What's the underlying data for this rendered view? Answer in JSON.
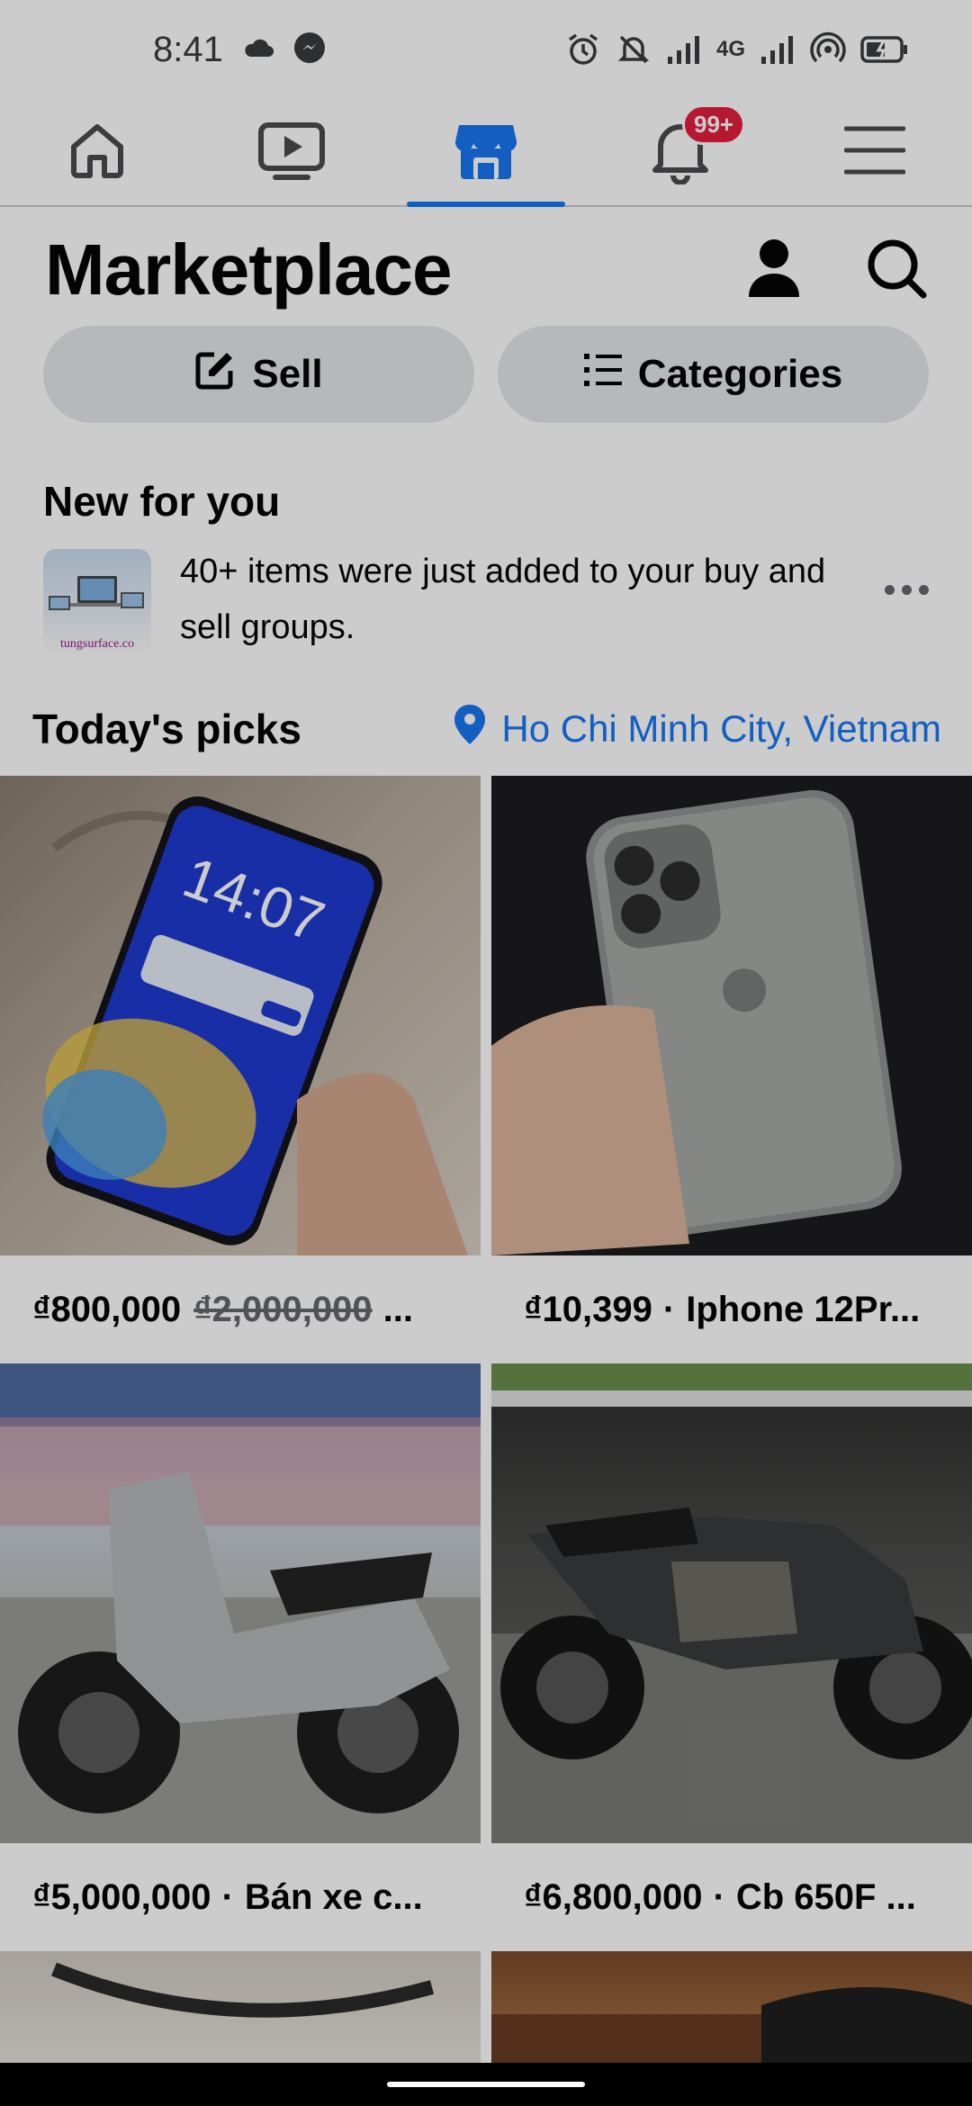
{
  "status_bar": {
    "time": "8:41",
    "network": "4G"
  },
  "top_nav": {
    "items": [
      {
        "name": "home",
        "icon": "home-icon"
      },
      {
        "name": "video",
        "icon": "video-icon"
      },
      {
        "name": "marketplace",
        "icon": "marketplace-icon",
        "active": true
      },
      {
        "name": "notifications",
        "icon": "bell-icon",
        "badge": "99+"
      },
      {
        "name": "menu",
        "icon": "hamburger-icon"
      }
    ]
  },
  "header": {
    "title": "Marketplace"
  },
  "actions": {
    "sell_label": "Sell",
    "categories_label": "Categories"
  },
  "new_for_you": {
    "title": "New for you",
    "message": "40+ items were just added to your buy and sell groups.",
    "thumb_caption": "tungsurface.co"
  },
  "todays_picks": {
    "title": "Today's picks",
    "location": "Ho Chi Minh City, Vietnam",
    "items": [
      {
        "price": "₫800,000",
        "original_price": "₫2,000,000",
        "suffix": "..."
      },
      {
        "price": "₫10,399",
        "name": "Iphone 12Pr..."
      },
      {
        "price": "₫5,000,000",
        "name": "Bán xe c..."
      },
      {
        "price": "₫6,800,000",
        "name": "Cb 650F ..."
      }
    ]
  },
  "colors": {
    "accent": "#1877f2",
    "badge": "#e41e3f",
    "pill_bg": "#e4e6eb"
  }
}
